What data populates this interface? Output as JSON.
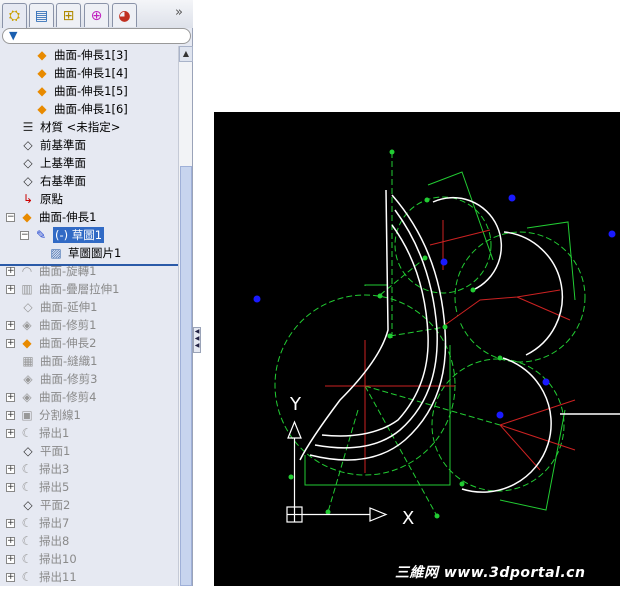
{
  "tabs": [
    {
      "icon": "feature-manager-icon"
    },
    {
      "icon": "property-manager-icon"
    },
    {
      "icon": "configuration-manager-icon"
    },
    {
      "icon": "dimxpert-icon"
    },
    {
      "icon": "display-manager-icon"
    }
  ],
  "more_label": "»",
  "tree": [
    {
      "label": "曲面-伸長1[3]",
      "icon": "extrude-surface-icon",
      "indent": 2
    },
    {
      "label": "曲面-伸長1[4]",
      "icon": "extrude-surface-icon",
      "indent": 2
    },
    {
      "label": "曲面-伸長1[5]",
      "icon": "extrude-surface-icon",
      "indent": 2
    },
    {
      "label": "曲面-伸長1[6]",
      "icon": "extrude-surface-icon",
      "indent": 2
    },
    {
      "label": "材質 <未指定>",
      "icon": "material-icon",
      "indent": 1
    },
    {
      "label": "前基準面",
      "icon": "plane-icon",
      "indent": 1
    },
    {
      "label": "上基準面",
      "icon": "plane-icon",
      "indent": 1
    },
    {
      "label": "右基準面",
      "icon": "plane-icon",
      "indent": 1
    },
    {
      "label": "原點",
      "icon": "origin-icon",
      "indent": 1
    },
    {
      "label": "曲面-伸長1",
      "icon": "extrude-surface-icon",
      "indent": 0,
      "expand": "−"
    },
    {
      "label": "(-) 草圖1",
      "icon": "sketch-icon",
      "indent": 1,
      "expand": "−",
      "selected": true
    },
    {
      "label": "草圖圖片1",
      "icon": "sketch-picture-icon",
      "indent": 3
    },
    {
      "label": "曲面-旋轉1",
      "icon": "revolve-surface-icon",
      "indent": 0,
      "expand": "+",
      "suppressed": true
    },
    {
      "label": "曲面-疊層拉伸1",
      "icon": "loft-surface-icon",
      "indent": 0,
      "expand": "+",
      "suppressed": true
    },
    {
      "label": "曲面-延伸1",
      "icon": "extend-surface-icon",
      "indent": 1,
      "suppressed": true
    },
    {
      "label": "曲面-修剪1",
      "icon": "trim-surface-icon",
      "indent": 0,
      "expand": "+",
      "suppressed": true
    },
    {
      "label": "曲面-伸長2",
      "icon": "extrude-surface-icon",
      "indent": 0,
      "expand": "+",
      "suppressed": true
    },
    {
      "label": "曲面-縫織1",
      "icon": "knit-surface-icon",
      "indent": 1,
      "suppressed": true
    },
    {
      "label": "曲面-修剪3",
      "icon": "trim-surface-icon",
      "indent": 1,
      "suppressed": true
    },
    {
      "label": "曲面-修剪4",
      "icon": "trim-surface-icon",
      "indent": 0,
      "expand": "+",
      "suppressed": true
    },
    {
      "label": "分割線1",
      "icon": "split-line-icon",
      "indent": 0,
      "expand": "+",
      "suppressed": true
    },
    {
      "label": "掃出1",
      "icon": "sweep-icon",
      "indent": 0,
      "expand": "+",
      "suppressed": true
    },
    {
      "label": "平面1",
      "icon": "plane-icon",
      "indent": 1,
      "suppressed": true
    },
    {
      "label": "掃出3",
      "icon": "sweep-icon",
      "indent": 0,
      "expand": "+",
      "suppressed": true
    },
    {
      "label": "掃出5",
      "icon": "sweep-icon",
      "indent": 0,
      "expand": "+",
      "suppressed": true
    },
    {
      "label": "平面2",
      "icon": "plane-icon",
      "indent": 1,
      "suppressed": true
    },
    {
      "label": "掃出7",
      "icon": "sweep-icon",
      "indent": 0,
      "expand": "+",
      "suppressed": true
    },
    {
      "label": "掃出8",
      "icon": "sweep-icon",
      "indent": 0,
      "expand": "+",
      "suppressed": true
    },
    {
      "label": "掃出10",
      "icon": "sweep-icon",
      "indent": 0,
      "expand": "+",
      "suppressed": true
    },
    {
      "label": "掃出11",
      "icon": "sweep-icon",
      "indent": 0,
      "expand": "+",
      "suppressed": true
    }
  ],
  "viewport": {
    "axis_x": "X",
    "axis_y": "Y",
    "background": "#000000",
    "sketch_color": "#22cc33",
    "dimension_color": "#cc2222",
    "curve_color": "#ffffff",
    "point_color": "#1a1aff"
  },
  "watermark": "三維网 www.3dportal.cn"
}
